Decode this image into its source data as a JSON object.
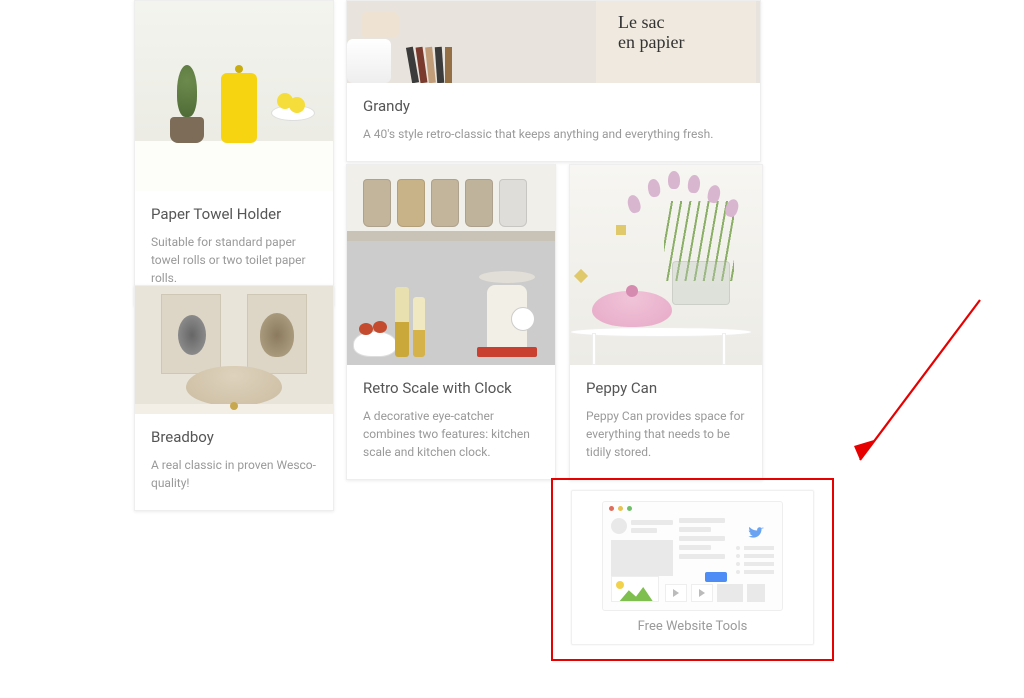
{
  "cards": {
    "paper_towel": {
      "title": "Paper Towel Holder",
      "desc": "Suitable for standard paper towel rolls or two toilet paper rolls."
    },
    "grandy": {
      "title": "Grandy",
      "desc": "A 40's style retro-classic that keeps anything and everything fresh."
    },
    "retro_scale": {
      "title": "Retro Scale with Clock",
      "desc": "A decorative eye-catcher combines two features: kitchen scale and kitchen clock."
    },
    "peppy": {
      "title": "Peppy Can",
      "desc": "Peppy Can provides space for everything that needs to be tidily stored."
    },
    "breadboy": {
      "title": "Breadboy",
      "desc": "A real classic in proven Wesco-quality!"
    }
  },
  "ad": {
    "label": "Free Website Tools"
  },
  "grandy_bag_text": "Le sac en papier"
}
